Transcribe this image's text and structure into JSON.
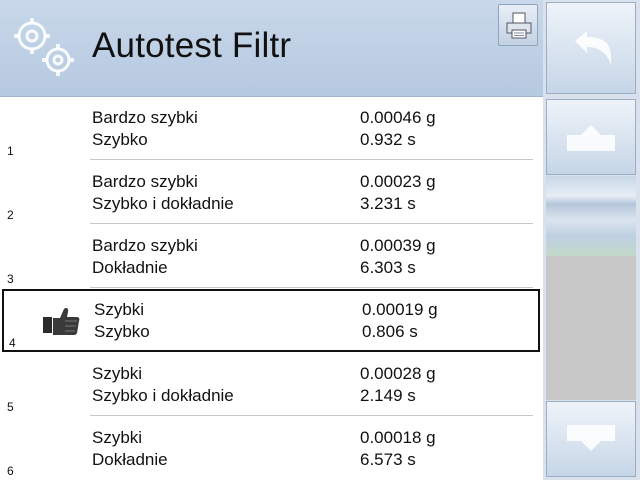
{
  "header": {
    "title": "Autotest Filtr"
  },
  "icons": {
    "settings": "gears-icon",
    "print": "printer-icon",
    "back": "back-arrow-icon",
    "up": "up-arrow-icon",
    "down": "down-arrow-icon",
    "best": "thumbs-up-icon"
  },
  "colors": {
    "header_bg": "#c1d2e6",
    "selected_border": "#111111",
    "scroll_track": "#c7c7c7"
  },
  "results": [
    {
      "num": "1",
      "filter": "Bardzo szybki",
      "mode": "Szybko",
      "deviation": "0.00046 g",
      "time": "0.932 s"
    },
    {
      "num": "2",
      "filter": "Bardzo szybki",
      "mode": "Szybko i dokładnie",
      "deviation": "0.00023 g",
      "time": "3.231 s"
    },
    {
      "num": "3",
      "filter": "Bardzo szybki",
      "mode": "Dokładnie",
      "deviation": "0.00039 g",
      "time": "6.303 s"
    },
    {
      "num": "4",
      "filter": "Szybki",
      "mode": "Szybko",
      "deviation": "0.00019 g",
      "time": "0.806 s",
      "selected": true
    },
    {
      "num": "5",
      "filter": "Szybki",
      "mode": "Szybko i dokładnie",
      "deviation": "0.00028 g",
      "time": "2.149 s"
    },
    {
      "num": "6",
      "filter": "Szybki",
      "mode": "Dokładnie",
      "deviation": "0.00018 g",
      "time": "6.573 s"
    }
  ]
}
